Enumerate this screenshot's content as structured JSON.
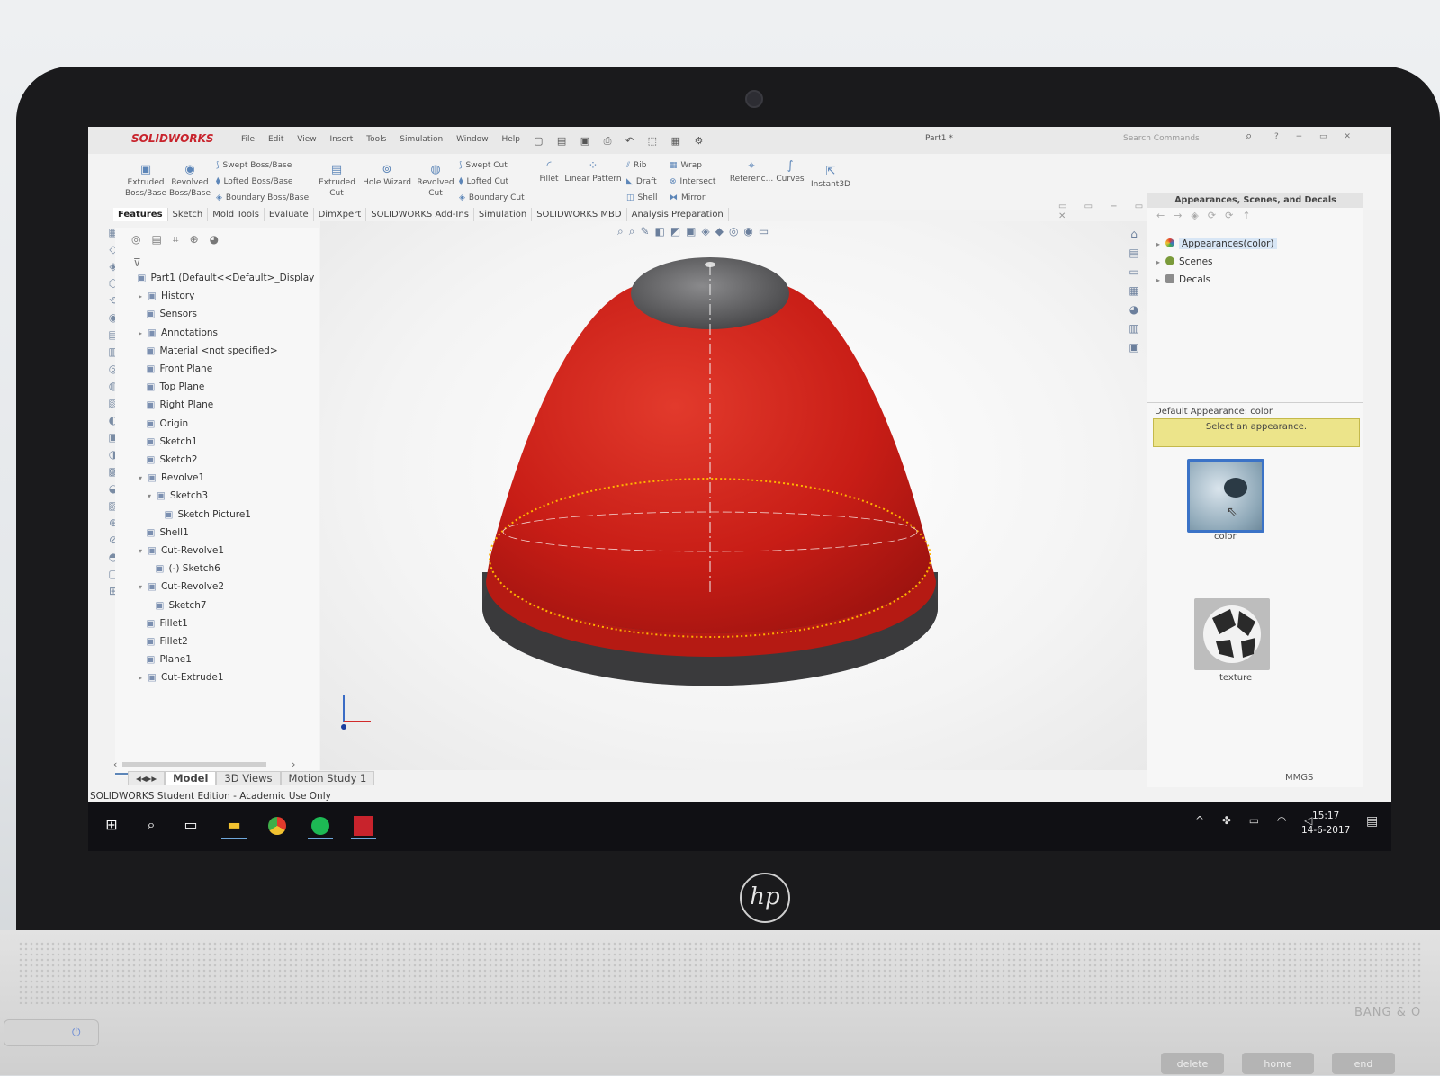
{
  "app": {
    "logo": "SOLIDWORKS",
    "menu": [
      "File",
      "Edit",
      "View",
      "Insert",
      "Tools",
      "Simulation",
      "Window",
      "Help"
    ],
    "document_title": "Part1 *",
    "search_placeholder": "Search Commands"
  },
  "ribbon": {
    "extruded_boss": "Extruded Boss/Base",
    "revolved_boss": "Revolved Boss/Base",
    "swept_boss": "Swept Boss/Base",
    "lofted_boss": "Lofted Boss/Base",
    "boundary_boss": "Boundary Boss/Base",
    "extruded_cut": "Extruded Cut",
    "hole_wizard": "Hole Wizard",
    "revolved_cut": "Revolved Cut",
    "swept_cut": "Swept Cut",
    "lofted_cut": "Lofted Cut",
    "boundary_cut": "Boundary Cut",
    "fillet": "Fillet",
    "linear_pattern": "Linear Pattern",
    "rib": "Rib",
    "draft": "Draft",
    "shell": "Shell",
    "wrap": "Wrap",
    "intersect": "Intersect",
    "mirror": "Mirror",
    "reference": "Referenc...",
    "curves": "Curves",
    "instant3d": "Instant3D"
  },
  "tabs": [
    "Features",
    "Sketch",
    "Mold Tools",
    "Evaluate",
    "DimXpert",
    "SOLIDWORKS Add-Ins",
    "Simulation",
    "SOLIDWORKS MBD",
    "Analysis Preparation"
  ],
  "tree": [
    {
      "label": "Part1  (Default<<Default>_Display",
      "level": 0,
      "arrow": ""
    },
    {
      "label": "History",
      "level": 1,
      "arrow": "▸"
    },
    {
      "label": "Sensors",
      "level": 1,
      "arrow": ""
    },
    {
      "label": "Annotations",
      "level": 1,
      "arrow": "▸"
    },
    {
      "label": "Material <not specified>",
      "level": 1,
      "arrow": ""
    },
    {
      "label": "Front Plane",
      "level": 1,
      "arrow": ""
    },
    {
      "label": "Top Plane",
      "level": 1,
      "arrow": ""
    },
    {
      "label": "Right Plane",
      "level": 1,
      "arrow": ""
    },
    {
      "label": "Origin",
      "level": 1,
      "arrow": ""
    },
    {
      "label": "Sketch1",
      "level": 1,
      "arrow": ""
    },
    {
      "label": "Sketch2",
      "level": 1,
      "arrow": ""
    },
    {
      "label": "Revolve1",
      "level": 1,
      "arrow": "▾"
    },
    {
      "label": "Sketch3",
      "level": 2,
      "arrow": "▾"
    },
    {
      "label": "Sketch Picture1",
      "level": 3,
      "arrow": ""
    },
    {
      "label": "Shell1",
      "level": 1,
      "arrow": ""
    },
    {
      "label": "Cut-Revolve1",
      "level": 1,
      "arrow": "▾"
    },
    {
      "label": "(-) Sketch6",
      "level": 2,
      "arrow": ""
    },
    {
      "label": "Cut-Revolve2",
      "level": 1,
      "arrow": "▾"
    },
    {
      "label": "Sketch7",
      "level": 2,
      "arrow": ""
    },
    {
      "label": "Fillet1",
      "level": 1,
      "arrow": ""
    },
    {
      "label": "Fillet2",
      "level": 1,
      "arrow": ""
    },
    {
      "label": "Plane1",
      "level": 1,
      "arrow": ""
    },
    {
      "label": "Cut-Extrude1",
      "level": 1,
      "arrow": "▸"
    }
  ],
  "bottom_tabs": [
    "Model",
    "3D Views",
    "Motion Study 1"
  ],
  "status": {
    "text": "SOLIDWORKS Student Edition - Academic Use Only",
    "units": "MMGS"
  },
  "task_pane": {
    "title": "Appearances, Scenes, and Decals",
    "items": [
      "Appearances(color)",
      "Scenes",
      "Decals"
    ],
    "default_label": "Default Appearance: color",
    "hint": "Select an appearance.",
    "swatches": [
      "color",
      "texture"
    ]
  },
  "taskbar": {
    "time": "15:17",
    "date": "14-6-2017"
  },
  "laptop": {
    "brand_mark": "hp",
    "audio_mark": "BANG & O",
    "keys": [
      "home",
      "end",
      "delete"
    ]
  },
  "colors": {
    "model_red": "#d0201a",
    "model_dark": "#3e3e40",
    "edge_highlight": "#ffb400",
    "accent": "#3b73c7"
  }
}
